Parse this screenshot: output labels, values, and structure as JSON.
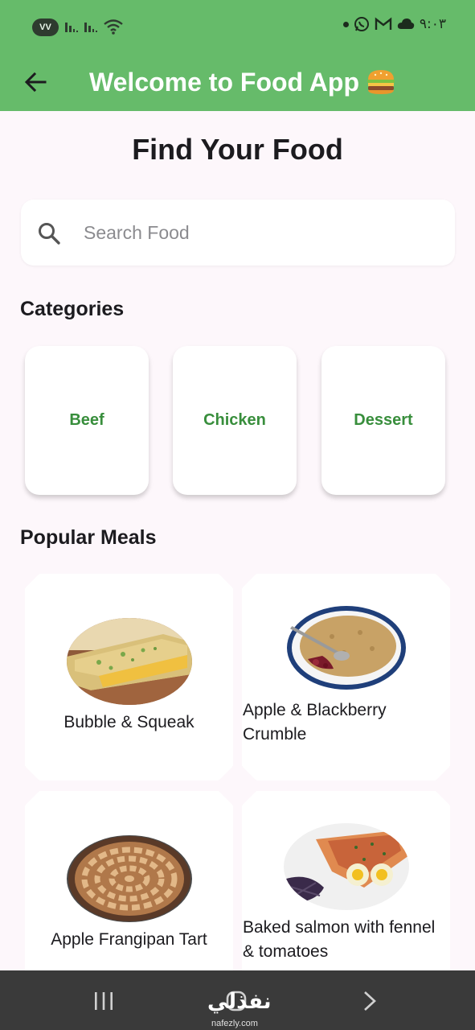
{
  "status_bar": {
    "badge": "VV",
    "time": "٩:٠٣",
    "icons": [
      "signal-icon",
      "signal-icon",
      "wifi-icon",
      "notification-dot-icon",
      "whatsapp-icon",
      "gmail-icon",
      "cloud-icon"
    ]
  },
  "app_bar": {
    "back_icon": "arrow-back-icon",
    "title": "Welcome to Food App",
    "title_emoji": "hamburger-icon",
    "color": "#66bb6a"
  },
  "heading": "Find Your Food",
  "search": {
    "placeholder": "Search Food",
    "value": "",
    "icon": "search-icon"
  },
  "categories": {
    "title": "Categories",
    "items": [
      {
        "label": "Beef"
      },
      {
        "label": "Chicken"
      },
      {
        "label": "Dessert"
      }
    ],
    "label_color": "#388e3c"
  },
  "popular": {
    "title": "Popular Meals",
    "meals": [
      {
        "name": "Bubble & Squeak",
        "image": "bubble-squeak-photo"
      },
      {
        "name": "Apple & Blackberry Crumble",
        "image": "crumble-photo"
      },
      {
        "name": "Apple Frangipan Tart",
        "image": "tart-photo"
      },
      {
        "name": "Baked salmon with fennel & tomatoes",
        "image": "salmon-photo"
      }
    ]
  },
  "nav_bar": {
    "items": [
      "recents-icon",
      "home-icon",
      "back-chevron-icon"
    ]
  },
  "watermark": {
    "text": "نفذلي",
    "url": "nafezly.com"
  }
}
